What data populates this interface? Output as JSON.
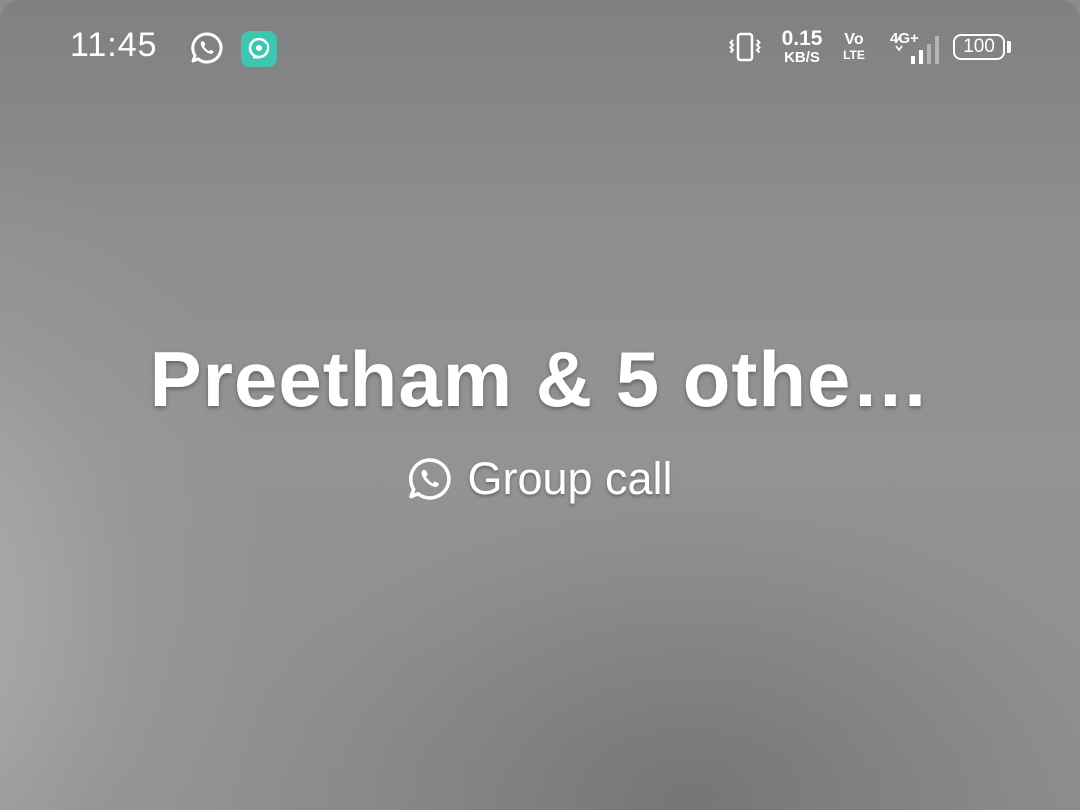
{
  "status_bar": {
    "time": "11:45",
    "notification_icons": [
      "whatsapp-icon",
      "screen-recorder-icon"
    ],
    "vibrate_icon": "vibrate-icon",
    "network_speed_value": "0.15",
    "network_speed_unit": "KB/S",
    "volte_top": "Vo",
    "volte_bottom": "LTE",
    "network_type": "4G+",
    "battery_level": "100",
    "accent_app_color": "#3ec6b0"
  },
  "call": {
    "caller_name": "Preetham & 5 othe…",
    "call_type_label": "Group call",
    "call_type_icon": "whatsapp-icon"
  }
}
